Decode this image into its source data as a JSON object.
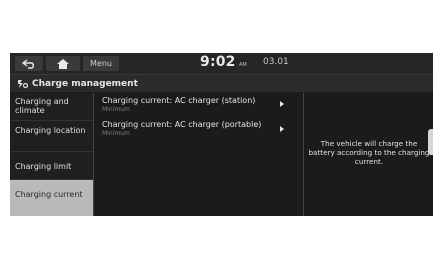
{
  "topbar": {
    "menu_label": "Menu",
    "time": "9:02",
    "ampm": "AM",
    "date": "03.01"
  },
  "header": {
    "title": "Charge management"
  },
  "left_menu": [
    {
      "label": "Charging and climate",
      "active": false
    },
    {
      "label": "Charging location",
      "active": false
    },
    {
      "label": "Charging limit",
      "active": false
    },
    {
      "label": "Charging current",
      "active": true
    }
  ],
  "options": [
    {
      "label": "Charging current: AC charger (station)",
      "value": "Minimum"
    },
    {
      "label": "Charging current: AC charger (portable)",
      "value": "Minimum"
    }
  ],
  "info_text": "The vehicle will charge the battery according to the charging current.",
  "colors": {
    "screen_bg": "#1b1b1b",
    "active_item_bg": "#b9b9b9"
  }
}
